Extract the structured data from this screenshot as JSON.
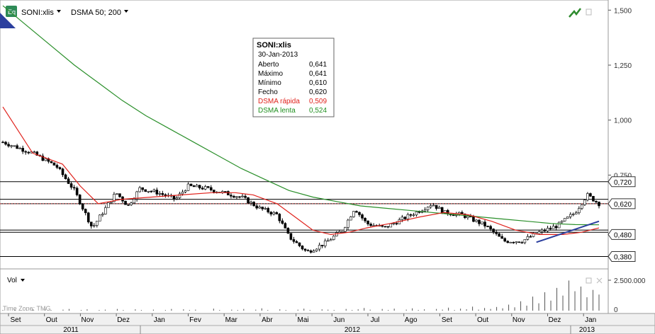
{
  "toolbar": {
    "eq_label": "Eq",
    "symbol": "SONI:xlis",
    "indicator": "DSMA 50; 200"
  },
  "info_box": {
    "title": "SONI:xlis",
    "date": "30-Jan-2013",
    "rows": [
      {
        "label": "Aberto",
        "value": "0,641",
        "color": "#000000"
      },
      {
        "label": "Máximo",
        "value": "0,641",
        "color": "#000000"
      },
      {
        "label": "Mínimo",
        "value": "0,610",
        "color": "#000000"
      },
      {
        "label": "Fecho",
        "value": "0,620",
        "color": "#000000"
      },
      {
        "label": "DSMA rápida",
        "value": "0,509",
        "color": "#e0221c"
      },
      {
        "label": "DSMA lenta",
        "value": "0,524",
        "color": "#1f8f1f"
      }
    ]
  },
  "volume_panel": {
    "label": "Vol",
    "timezone": "Time Zone: TMG",
    "axis_labels": [
      "2.500.000",
      "0"
    ]
  },
  "colors": {
    "slow_ma": "#2a8f2a",
    "fast_ma": "#e0221c",
    "trend": "#2b3f9e",
    "up_candle": "#ffffff",
    "down_candle": "#000000"
  },
  "chart_data": {
    "type": "candlestick",
    "title": "SONI:xlis",
    "y_axis": {
      "ticks": [
        "1,500",
        "1,250",
        "1,000",
        "0,750"
      ],
      "price_labels": [
        "0,720",
        "0,620",
        "0,480",
        "0,380"
      ],
      "range": [
        0.33,
        1.53
      ]
    },
    "x_axis": {
      "months": [
        "Set",
        "Out",
        "Nov",
        "Dez",
        "Jan",
        "Fev",
        "Mar",
        "Abr",
        "Mai",
        "Jun",
        "Jul",
        "Ago",
        "Set",
        "Out",
        "Nov",
        "Dez",
        "Jan"
      ],
      "years": [
        "2011",
        "2012",
        "2013"
      ]
    },
    "horizontal_levels": [
      0.72,
      0.64,
      0.62,
      0.5,
      0.49,
      0.38
    ],
    "close_path": [
      [
        0,
        0.9
      ],
      [
        0.05,
        0.85
      ],
      [
        0.09,
        0.79
      ],
      [
        0.12,
        0.68
      ],
      [
        0.15,
        0.51
      ],
      [
        0.17,
        0.59
      ],
      [
        0.19,
        0.67
      ],
      [
        0.21,
        0.61
      ],
      [
        0.23,
        0.69
      ],
      [
        0.26,
        0.67
      ],
      [
        0.29,
        0.64
      ],
      [
        0.31,
        0.7
      ],
      [
        0.34,
        0.69
      ],
      [
        0.37,
        0.67
      ],
      [
        0.4,
        0.65
      ],
      [
        0.43,
        0.6
      ],
      [
        0.46,
        0.57
      ],
      [
        0.48,
        0.47
      ],
      [
        0.51,
        0.4
      ],
      [
        0.54,
        0.44
      ],
      [
        0.57,
        0.5
      ],
      [
        0.59,
        0.6
      ],
      [
        0.61,
        0.53
      ],
      [
        0.64,
        0.51
      ],
      [
        0.67,
        0.55
      ],
      [
        0.7,
        0.59
      ],
      [
        0.72,
        0.62
      ],
      [
        0.74,
        0.58
      ],
      [
        0.77,
        0.57
      ],
      [
        0.81,
        0.52
      ],
      [
        0.84,
        0.45
      ],
      [
        0.87,
        0.45
      ],
      [
        0.9,
        0.49
      ],
      [
        0.93,
        0.52
      ],
      [
        0.96,
        0.58
      ],
      [
        0.98,
        0.66
      ],
      [
        1.0,
        0.62
      ]
    ],
    "fast_ma_path": [
      [
        0,
        1.06
      ],
      [
        0.05,
        0.85
      ],
      [
        0.1,
        0.8
      ],
      [
        0.13,
        0.7
      ],
      [
        0.16,
        0.62
      ],
      [
        0.2,
        0.64
      ],
      [
        0.25,
        0.65
      ],
      [
        0.3,
        0.66
      ],
      [
        0.35,
        0.67
      ],
      [
        0.39,
        0.67
      ],
      [
        0.42,
        0.66
      ],
      [
        0.46,
        0.62
      ],
      [
        0.49,
        0.56
      ],
      [
        0.52,
        0.5
      ],
      [
        0.55,
        0.48
      ],
      [
        0.58,
        0.49
      ],
      [
        0.61,
        0.51
      ],
      [
        0.65,
        0.53
      ],
      [
        0.7,
        0.56
      ],
      [
        0.74,
        0.58
      ],
      [
        0.78,
        0.57
      ],
      [
        0.82,
        0.54
      ],
      [
        0.86,
        0.5
      ],
      [
        0.9,
        0.48
      ],
      [
        0.94,
        0.48
      ],
      [
        0.97,
        0.49
      ],
      [
        1.0,
        0.51
      ]
    ],
    "slow_ma_path": [
      [
        0,
        1.52
      ],
      [
        0.04,
        1.43
      ],
      [
        0.08,
        1.34
      ],
      [
        0.12,
        1.25
      ],
      [
        0.16,
        1.17
      ],
      [
        0.2,
        1.09
      ],
      [
        0.24,
        1.02
      ],
      [
        0.28,
        0.96
      ],
      [
        0.32,
        0.9
      ],
      [
        0.36,
        0.84
      ],
      [
        0.4,
        0.78
      ],
      [
        0.44,
        0.73
      ],
      [
        0.48,
        0.68
      ],
      [
        0.52,
        0.65
      ],
      [
        0.56,
        0.63
      ],
      [
        0.6,
        0.61
      ],
      [
        0.64,
        0.6
      ],
      [
        0.68,
        0.59
      ],
      [
        0.72,
        0.58
      ],
      [
        0.76,
        0.57
      ],
      [
        0.8,
        0.56
      ],
      [
        0.84,
        0.55
      ],
      [
        0.88,
        0.54
      ],
      [
        0.92,
        0.53
      ],
      [
        0.96,
        0.525
      ],
      [
        1.0,
        0.524
      ]
    ],
    "trend_line": [
      [
        0.895,
        0.445
      ],
      [
        1.0,
        0.54
      ]
    ],
    "volume_bars": [
      0.02,
      0.01,
      0.03,
      0.0,
      0.02,
      0.04,
      0.01,
      0.06,
      0.02,
      0.0,
      0.03,
      0.05,
      0.01,
      0.02,
      0.04,
      0.0,
      0.02,
      0.03,
      0.01,
      0.05,
      0.02,
      0.0,
      0.04,
      0.02,
      0.01,
      0.03,
      0.0,
      0.02,
      0.05,
      0.01,
      0.04,
      0.02,
      0.03,
      0.0,
      0.01,
      0.06,
      0.02,
      0.01,
      0.03,
      0.02,
      0.05,
      0.0,
      0.03,
      0.07,
      0.02,
      0.01,
      0.04,
      0.02,
      0.0,
      0.03,
      0.06,
      0.02,
      0.01,
      0.04,
      0.03,
      0.02,
      0.0,
      0.05,
      0.02,
      0.04,
      0.08,
      0.03,
      0.01,
      0.05,
      0.02,
      0.06,
      0.0,
      0.03,
      0.07,
      0.02,
      0.04,
      0.01,
      0.05,
      0.03,
      0.09,
      0.02,
      0.06,
      0.04,
      0.12,
      0.03,
      0.08,
      0.05,
      0.11,
      0.07,
      0.18,
      0.1,
      0.28,
      0.15,
      0.42,
      0.22,
      0.55,
      0.3,
      0.68,
      0.45,
      0.9,
      0.58,
      0.72,
      0.4,
      0.62,
      0.48
    ]
  }
}
